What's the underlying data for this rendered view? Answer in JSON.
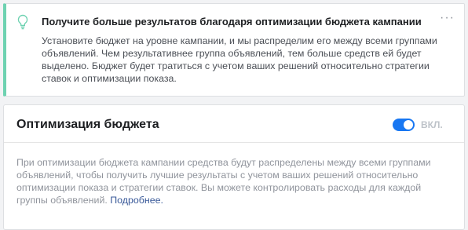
{
  "tip": {
    "icon": "lightbulb-icon",
    "title": "Получите больше результатов благодаря оптимизации бюджета кампании",
    "body": "Установите бюджет на уровне кампании, и мы распределим его между всеми группами объявлений. Чем результативнее группа объявлений, тем больше средств ей будет выделено. Бюджет будет тратиться с учетом ваших решений относительно стратегии ставок и оптимизации показа.",
    "menu_icon": "more-icon",
    "accent_color": "#6ed2b1"
  },
  "budget_card": {
    "title": "Оптимизация бюджета",
    "toggle_on": true,
    "toggle_label": "ВКЛ.",
    "toggle_color": "#1877f2",
    "description": "При оптимизации бюджета кампании средства будут распределены между всеми группами объявлений, чтобы получить лучшие результаты с учетом ваших решений относительно оптимизации показа и стратегии ставок. Вы можете контролировать расходы для каждой группы объявлений. ",
    "learn_more": "Подробнее."
  }
}
